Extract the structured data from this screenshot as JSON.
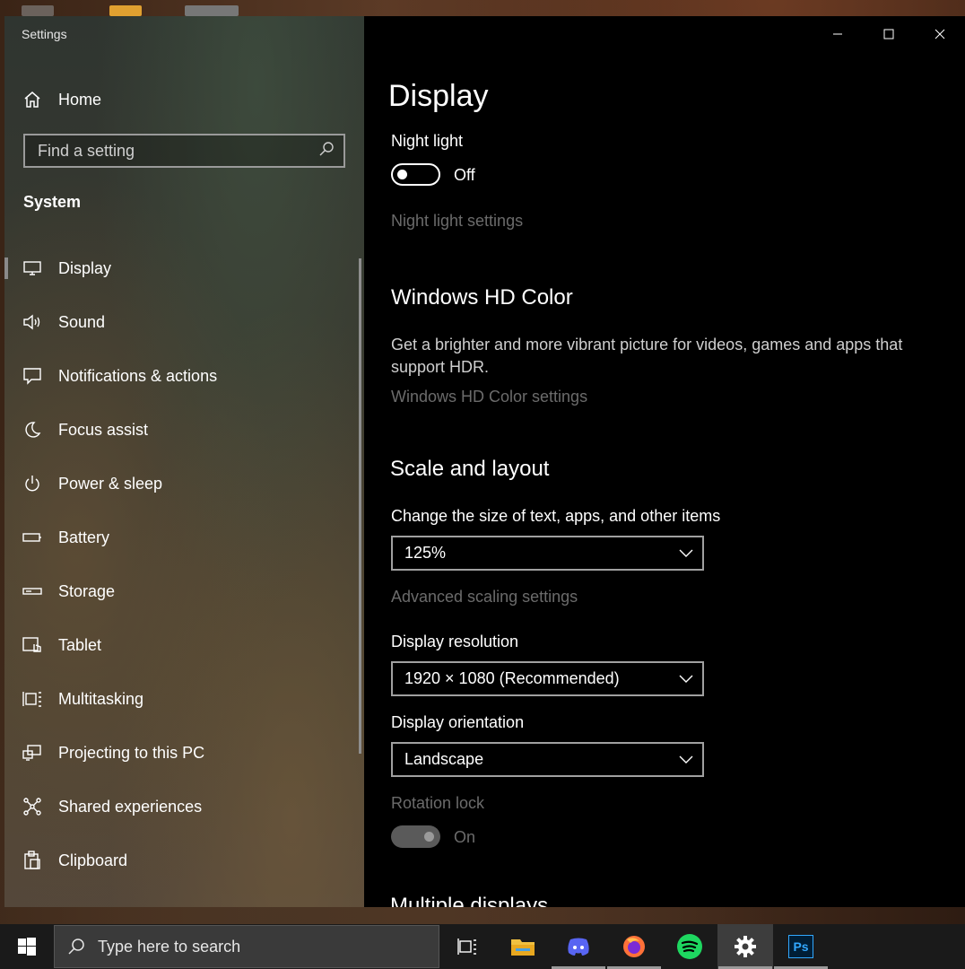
{
  "window": {
    "app_title": "Settings",
    "controls": {
      "minimize": "minimize",
      "maximize": "maximize",
      "close": "close"
    }
  },
  "sidebar": {
    "home_label": "Home",
    "search_placeholder": "Find a setting",
    "section_label": "System",
    "items": [
      {
        "label": "Display",
        "icon": "monitor-icon",
        "active": true
      },
      {
        "label": "Sound",
        "icon": "speaker-icon"
      },
      {
        "label": "Notifications & actions",
        "icon": "notification-icon"
      },
      {
        "label": "Focus assist",
        "icon": "moon-icon"
      },
      {
        "label": "Power & sleep",
        "icon": "power-icon"
      },
      {
        "label": "Battery",
        "icon": "battery-icon"
      },
      {
        "label": "Storage",
        "icon": "storage-icon"
      },
      {
        "label": "Tablet",
        "icon": "tablet-icon"
      },
      {
        "label": "Multitasking",
        "icon": "multitasking-icon"
      },
      {
        "label": "Projecting to this PC",
        "icon": "projecting-icon"
      },
      {
        "label": "Shared experiences",
        "icon": "shared-icon"
      },
      {
        "label": "Clipboard",
        "icon": "clipboard-icon"
      }
    ]
  },
  "main": {
    "title": "Display",
    "night_light": {
      "label": "Night light",
      "state": "Off",
      "link": "Night light settings"
    },
    "hd_color": {
      "heading": "Windows HD Color",
      "description": "Get a brighter and more vibrant picture for videos, games and apps that support HDR.",
      "link": "Windows HD Color settings"
    },
    "scale": {
      "heading": "Scale and layout",
      "size_label": "Change the size of text, apps, and other items",
      "size_value": "125%",
      "advanced_link": "Advanced scaling settings",
      "resolution_label": "Display resolution",
      "resolution_value": "1920 × 1080 (Recommended)",
      "orientation_label": "Display orientation",
      "orientation_value": "Landscape",
      "rotation_label": "Rotation lock",
      "rotation_state": "On"
    },
    "cutoff_heading": "Multiple displays"
  },
  "taskbar": {
    "search_placeholder": "Type here to search",
    "apps": [
      "task-view-icon",
      "file-explorer-icon",
      "discord-icon",
      "firefox-icon",
      "spotify-icon",
      "settings-icon",
      "photoshop-icon"
    ],
    "photoshop_label": "Ps"
  },
  "colors": {
    "content_bg": "#000000",
    "dim_link": "#6b6b6b",
    "taskbar_bg": "#1a1a1a",
    "spotify": "#1ed760",
    "discord": "#5865f2"
  }
}
